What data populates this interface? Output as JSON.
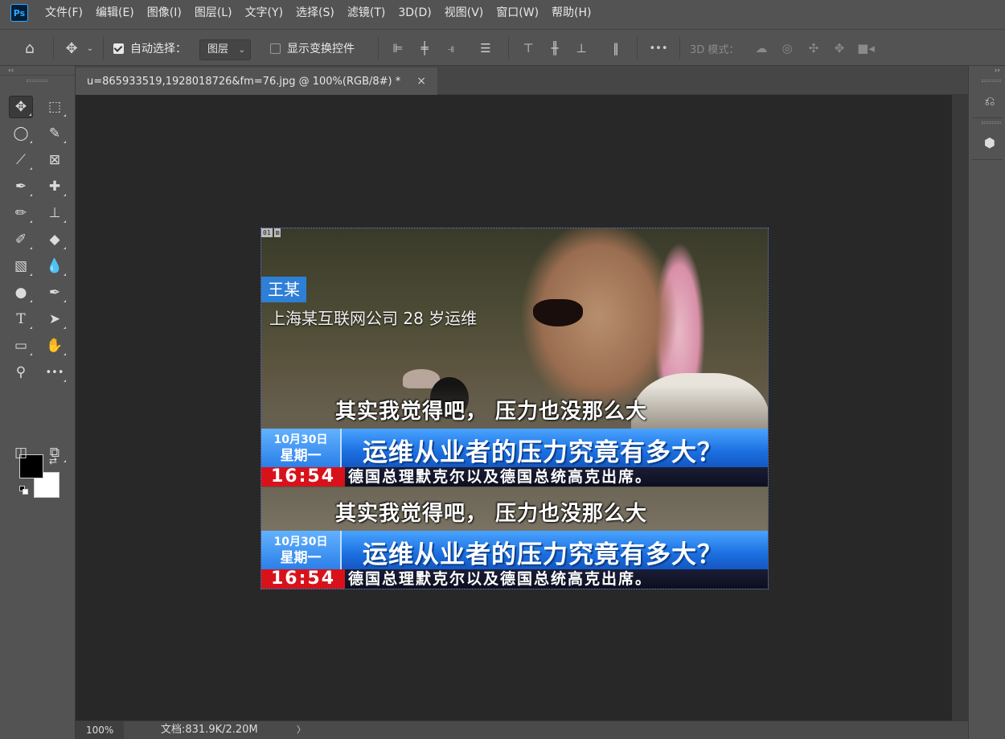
{
  "app": {
    "logo": "Ps"
  },
  "menu": [
    "文件(F)",
    "编辑(E)",
    "图像(I)",
    "图层(L)",
    "文字(Y)",
    "选择(S)",
    "滤镜(T)",
    "3D(D)",
    "视图(V)",
    "窗口(W)",
    "帮助(H)"
  ],
  "options": {
    "auto_select_label": "自动选择：",
    "auto_select_checked": true,
    "layer_dropdown_value": "图层",
    "show_transform_label": "显示变换控件",
    "show_transform_checked": false,
    "more": "•••",
    "mode_3d_label": "3D 模式："
  },
  "document": {
    "tab_title": "u=865933519,1928018726&fm=76.jpg @ 100%(RGB/8#) *",
    "close": "×"
  },
  "image": {
    "badges": [
      "01",
      "⊠"
    ],
    "name_tag": "王某",
    "subtitle": "上海某互联网公司 28 岁运维",
    "strips": [
      {
        "quote": "其实我觉得吧，  压力也没那么大",
        "date_line1": "10月30日",
        "date_line2": "星期一",
        "headline": "运维从业者的压力究竟有多大？",
        "time": "16:54",
        "ticker": "德国总理默克尔以及德国总统高克出席。"
      },
      {
        "quote": "其实我觉得吧，  压力也没那么大",
        "date_line1": "10月30日",
        "date_line2": "星期一",
        "headline": "运维从业者的压力究竟有多大？",
        "time": "16:54",
        "ticker": "德国总理默克尔以及德国总统高克出席。"
      }
    ]
  },
  "status": {
    "zoom": "100%",
    "docinfo": "文档:831.9K/2.20M",
    "arrow": "〉"
  },
  "colors": {
    "foreground": "#000000",
    "background": "#ffffff",
    "accent": "#31a8ff"
  }
}
